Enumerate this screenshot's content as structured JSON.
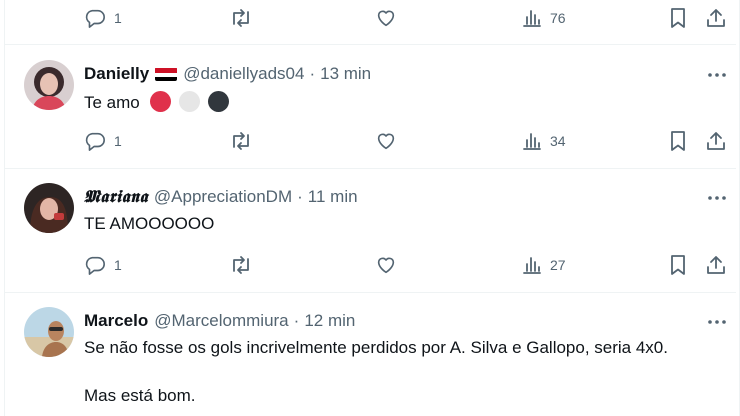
{
  "colors": {
    "text": "#0f1419",
    "muted": "#536471",
    "divider": "#eff3f4"
  },
  "icons": {
    "reply": "reply-icon",
    "retweet": "retweet-icon",
    "like": "heart-icon",
    "views": "views-icon",
    "bookmark": "bookmark-icon",
    "share": "share-icon",
    "more": "more-icon"
  },
  "top_tweet": {
    "reply_count": "1",
    "views": "76"
  },
  "tweets": [
    {
      "name": "Danielly",
      "handle": "@daniellyads04",
      "sep": "·",
      "time": "13 min",
      "text": "Te amo",
      "emoji_colors": [
        "#e0314b",
        "#e6e6e6",
        "#31373d"
      ],
      "reply_count": "1",
      "views": "34"
    },
    {
      "name": "𝕸𝖆𝖗𝖎𝖆𝖓𝖆",
      "handle": "@AppreciationDM",
      "sep": "·",
      "time": "11 min",
      "text": "TE AMOOOOOO",
      "reply_count": "1",
      "views": "27"
    },
    {
      "name": "Marcelo",
      "handle": "@Marcelommiura",
      "sep": "·",
      "time": "12 min",
      "text_line1": "Se não fosse os gols incrivelmente perdidos por A. Silva e Gallopo, seria 4x0.",
      "text_line2": "Mas está bom."
    }
  ]
}
